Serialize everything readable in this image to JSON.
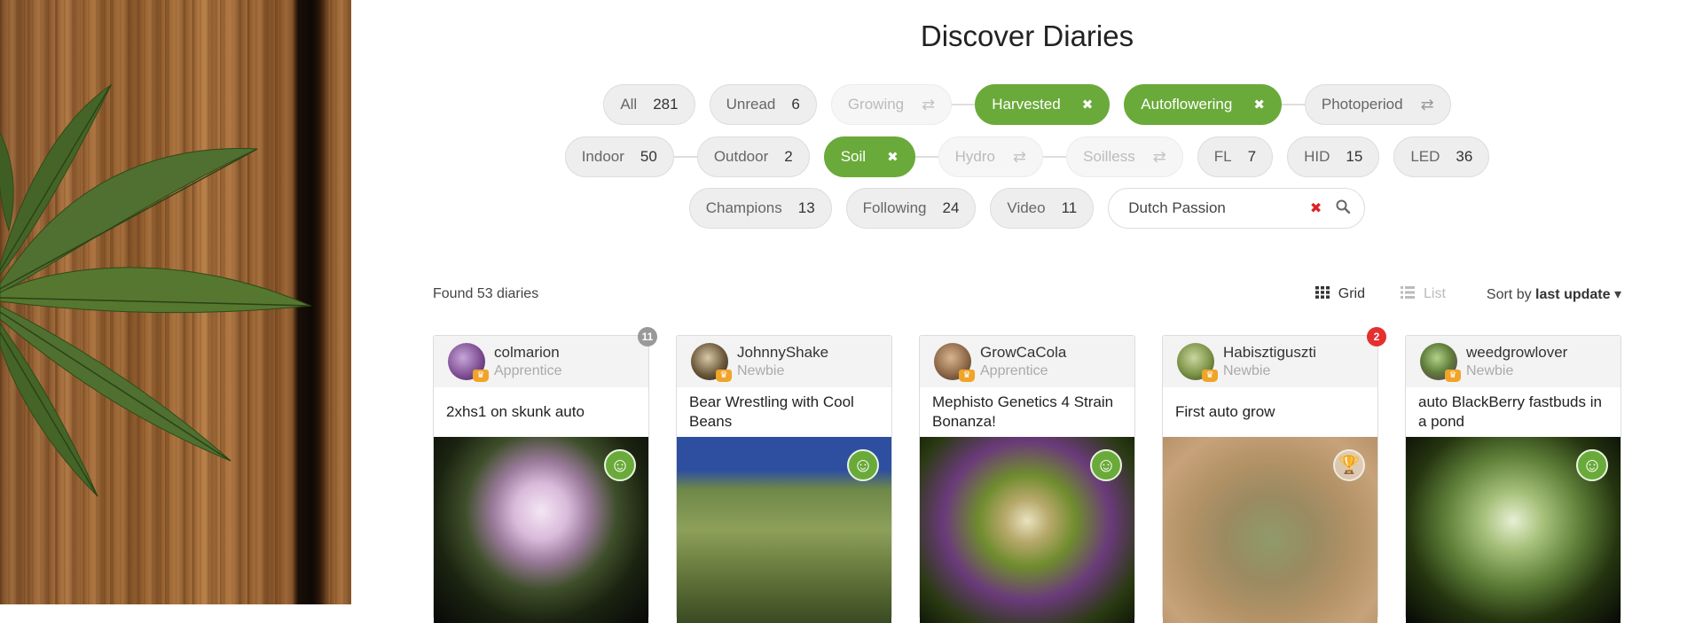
{
  "page": {
    "title": "Discover Diaries"
  },
  "filters": {
    "row1": [
      {
        "label": "All",
        "count": "281"
      },
      {
        "label": "Unread",
        "count": "6"
      },
      {
        "label": "Growing"
      },
      {
        "label": "Harvested"
      },
      {
        "label": "Autoflowering"
      },
      {
        "label": "Photoperiod"
      }
    ],
    "row2": [
      {
        "label": "Indoor",
        "count": "50"
      },
      {
        "label": "Outdoor",
        "count": "2"
      },
      {
        "label": "Soil"
      },
      {
        "label": "Hydro"
      },
      {
        "label": "Soilless"
      },
      {
        "label": "FL",
        "count": "7"
      },
      {
        "label": "HID",
        "count": "15"
      },
      {
        "label": "LED",
        "count": "36"
      }
    ],
    "row3": [
      {
        "label": "Champions",
        "count": "13"
      },
      {
        "label": "Following",
        "count": "24"
      },
      {
        "label": "Video",
        "count": "11"
      }
    ]
  },
  "search": {
    "value": "Dutch Passion"
  },
  "results": {
    "found": "Found 53 diaries",
    "view_grid": "Grid",
    "view_list": "List",
    "sort_prefix": "Sort by",
    "sort_value": "last update"
  },
  "icons": {
    "swap": "⇄",
    "close": "✖",
    "search": "⚲",
    "grid": "▦",
    "list": "☰",
    "caret": "▾",
    "smile": "☺",
    "trophy": "🏆",
    "crown": "♛"
  },
  "colors": {
    "accent_green": "#6aaa3a",
    "badge_red": "#e53030",
    "badge_grey": "#999999"
  },
  "cards": [
    {
      "user": "colmarion",
      "rank": "Apprentice",
      "title": "2xhs1 on skunk auto",
      "badge": "11",
      "status": "smile"
    },
    {
      "user": "JohnnyShake",
      "rank": "Newbie",
      "title": "Bear Wrestling with Cool Beans",
      "status": "smile"
    },
    {
      "user": "GrowCaCola",
      "rank": "Apprentice",
      "title": "Mephisto Genetics 4 Strain Bonanza!",
      "status": "smile"
    },
    {
      "user": "Habisztiguszti",
      "rank": "Newbie",
      "title": "First auto grow",
      "badge": "2",
      "status": "trophy"
    },
    {
      "user": "weedgrowlover",
      "rank": "Newbie",
      "title": "auto BlackBerry fastbuds in a pond",
      "status": "smile"
    }
  ]
}
